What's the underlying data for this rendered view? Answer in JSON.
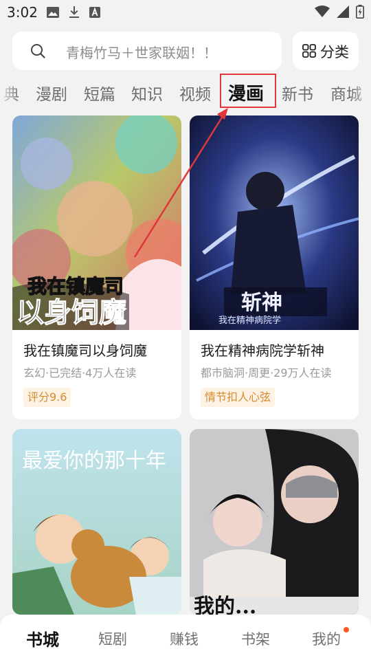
{
  "status_bar": {
    "time": "3:02",
    "left_icons": [
      "image-icon",
      "download-icon",
      "a-badge-icon"
    ],
    "right_icons": [
      "wifi-icon",
      "signal-icon",
      "battery-charging-icon"
    ]
  },
  "search": {
    "placeholder": "青梅竹马＋世家联姻！！",
    "icon": "search-icon"
  },
  "category_button": {
    "label": "分类",
    "icon": "grid-icon"
  },
  "tabs": [
    {
      "label": "典",
      "active": false
    },
    {
      "label": "漫剧",
      "active": false
    },
    {
      "label": "短篇",
      "active": false
    },
    {
      "label": "知识",
      "active": false
    },
    {
      "label": "视频",
      "active": false
    },
    {
      "label": "漫画",
      "active": true
    },
    {
      "label": "新书",
      "active": false
    },
    {
      "label": "商城",
      "active": false
    }
  ],
  "cards": [
    {
      "title": "我在镇魔司以身饲魔",
      "meta": "玄幻·已完结·4万人在读",
      "badge": "评分9.6",
      "cover_text": [
        "我在镇魔司",
        "以身饲魔"
      ]
    },
    {
      "title": "我在精神病院学斩神",
      "meta": "都市脑洞·周更·29万人在读",
      "badge": "情节扣人心弦",
      "cover_text": [
        "斩神",
        "我在精神病院学"
      ]
    },
    {
      "title": "",
      "meta": "",
      "badge": "",
      "cover_text": [
        "最爱你的那十年"
      ]
    },
    {
      "title": "",
      "meta": "",
      "badge": "",
      "cover_text": [
        "我的..."
      ]
    }
  ],
  "bottom_nav": [
    {
      "label": "书城",
      "active": true
    },
    {
      "label": "短剧",
      "active": false
    },
    {
      "label": "赚钱",
      "active": false
    },
    {
      "label": "书架",
      "active": false
    },
    {
      "label": "我的",
      "active": false,
      "has_dot": true
    }
  ],
  "colors": {
    "background": "#f2f2f2",
    "highlight": "#e0353b",
    "badge_bg": "#fdf2e3",
    "badge_text": "#d78a2e",
    "notification_dot": "#ff5a24"
  }
}
